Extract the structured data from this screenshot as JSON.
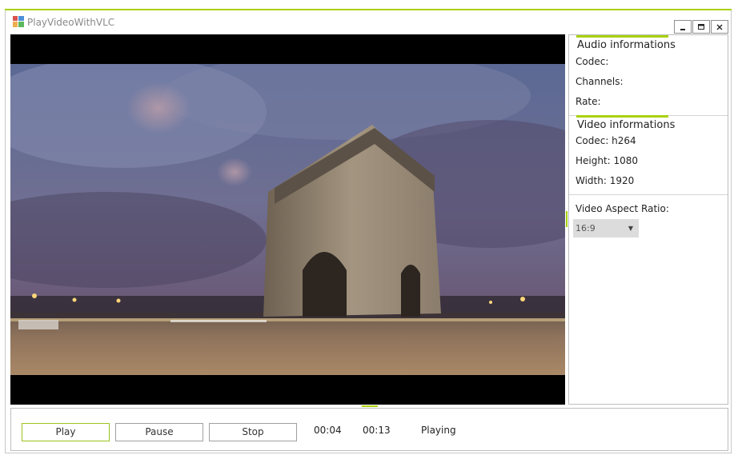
{
  "window": {
    "title": "PlayVideoWithVLC",
    "accent_color": "#a9d10f"
  },
  "audio_info": {
    "title": "Audio informations",
    "codec": "Codec:",
    "channels": "Channels:",
    "rate": "Rate:"
  },
  "video_info": {
    "title": "Video informations",
    "codec": "Codec: h264",
    "height": "Height: 1080",
    "width": "Width: 1920"
  },
  "aspect_ratio": {
    "label": "Video Aspect Ratio:",
    "selected": "16:9"
  },
  "controls": {
    "play_label": "Play",
    "pause_label": "Pause",
    "stop_label": "Stop",
    "current_time": "00:04",
    "total_time": "00:13",
    "status": "Playing"
  },
  "icons": {
    "app": "app-icon",
    "minimize": "minimize-icon",
    "maximize": "maximize-icon",
    "close": "close-icon",
    "dropdown": "chevron-down-icon"
  }
}
